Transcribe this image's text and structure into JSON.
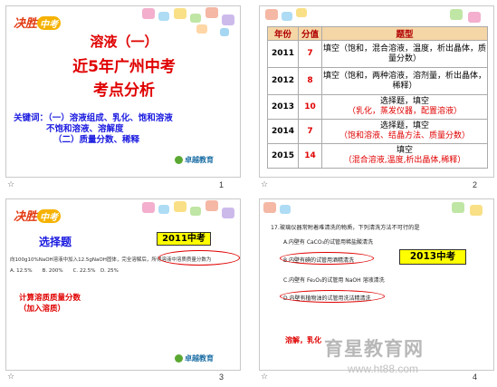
{
  "slides": [
    {
      "number": "1",
      "logo": {
        "a": "决胜",
        "b": "中考"
      },
      "title1": "溶液（一）",
      "title2": "近5年广州中考",
      "title3": "考点分析",
      "keywords_line1": "关键词：（一）溶液组成、乳化、饱和溶液",
      "keywords_line2": "不饱和溶液、溶解度",
      "keywords_line3": "（二）质量分数、稀释",
      "brand": "卓越教育"
    },
    {
      "number": "2",
      "table": {
        "headers": [
          "年份",
          "分值",
          "题型"
        ],
        "rows": [
          {
            "year": "2011",
            "score": "7",
            "type": "填空（饱和，混合溶液，温度，析出晶体，质量分数）"
          },
          {
            "year": "2012",
            "score": "8",
            "type": "填空（饱和，两种溶液，溶剂量，析出晶体，稀释）"
          },
          {
            "year": "2013",
            "score": "10",
            "type": "选择题，填空",
            "type2": "（乳化，蒸发仪器，配置溶液）"
          },
          {
            "year": "2014",
            "score": "7",
            "type": "选择题，填空",
            "type2": "（饱和溶液、结晶方法、质量分数）"
          },
          {
            "year": "2015",
            "score": "14",
            "type": "填空",
            "type2": "（混合溶液,温度,析出晶体,稀释）"
          }
        ]
      }
    },
    {
      "number": "3",
      "logo": {
        "a": "决胜",
        "b": "中考"
      },
      "heading": "选择题",
      "badge": "2011中考",
      "question": "向100g10%NaOH溶液中加入12.5gNaOH固体，完全溶解后，所得溶液中溶质质量分数为",
      "circled": "所得溶液中溶质质量分数为",
      "options": "A. 12.5%　　B. 200%　　C. 22.5%　D. 25%",
      "note1": "计算溶质质量分数",
      "note2": "（加入溶质）",
      "brand": "卓越教育"
    },
    {
      "number": "4",
      "question": "17.玻璃仪器常附着难清洗的物质，下列清洗方法不可行的是",
      "badge": "2013中考",
      "options": [
        "A.内壁有 CaCO₃的试管用稀盐酸清洗",
        "B.内壁有碘的试管用酒精清洗",
        "C.内壁有 Fe₂O₃的试管用 NaOH 溶液清洗",
        "D.内壁有植物油的试管用洗洁精清洗"
      ],
      "note": "溶解，乳化"
    }
  ],
  "watermark": {
    "text": "育星教育网",
    "url": "www.ht88.com"
  }
}
